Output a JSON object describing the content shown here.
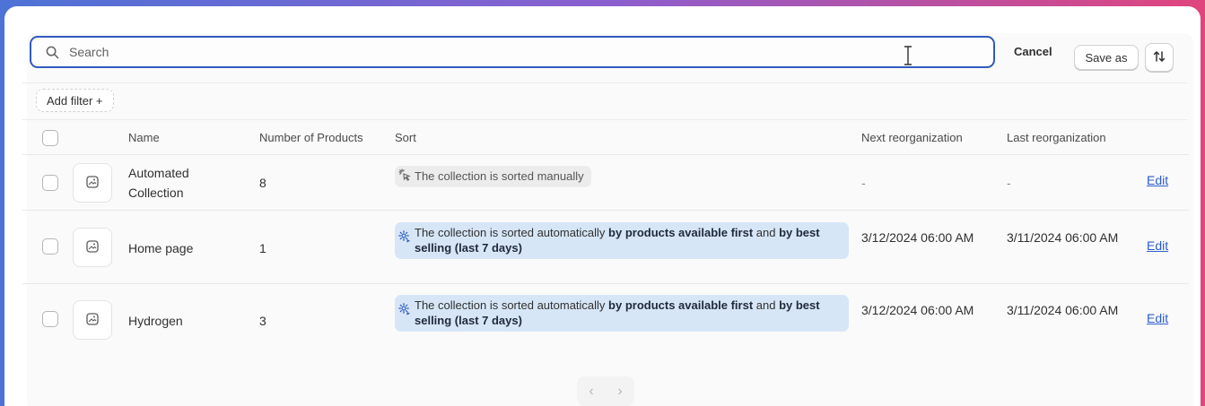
{
  "search": {
    "placeholder": "Search",
    "cancel_label": "Cancel",
    "save_as_label": "Save as"
  },
  "filters": {
    "add_filter_label": "Add filter +"
  },
  "table": {
    "headers": {
      "name": "Name",
      "products": "Number of Products",
      "sort": "Sort",
      "next": "Next reorganization",
      "last": "Last reorganization"
    },
    "rows": [
      {
        "name": "Automated Collection",
        "products": "8",
        "sort_text": "The collection is sorted manually",
        "next": "-",
        "last": "-",
        "action": "Edit"
      },
      {
        "name": "Home page",
        "products": "1",
        "sort_prefix": "The collection is sorted automatically ",
        "sort_bold1": "by products available first",
        "sort_mid": " and ",
        "sort_bold2": "by best selling (last 7 days)",
        "next": "3/12/2024 06:00 AM",
        "last": "3/11/2024 06:00 AM",
        "action": "Edit"
      },
      {
        "name": "Hydrogen",
        "products": "3",
        "sort_prefix": "The collection is sorted automatically ",
        "sort_bold1": "by products available first",
        "sort_mid": " and ",
        "sort_bold2": "by best selling (last 7 days)",
        "next": "3/12/2024 06:00 AM",
        "last": "3/11/2024 06:00 AM",
        "action": "Edit"
      }
    ]
  },
  "pagination": {
    "prev_label": "‹",
    "next_label": "›"
  },
  "colors": {
    "accent": "#2f5bbf",
    "link": "#2c5ccf",
    "auto_badge": "#d7e6f7",
    "manual_badge": "#ececec"
  },
  "icons": [
    "search-icon",
    "text-cursor-icon",
    "sort-arrows-icon",
    "image-placeholder-icon",
    "manual-sort-icon",
    "gear-sort-icon",
    "chevron-left-icon",
    "chevron-right-icon"
  ]
}
